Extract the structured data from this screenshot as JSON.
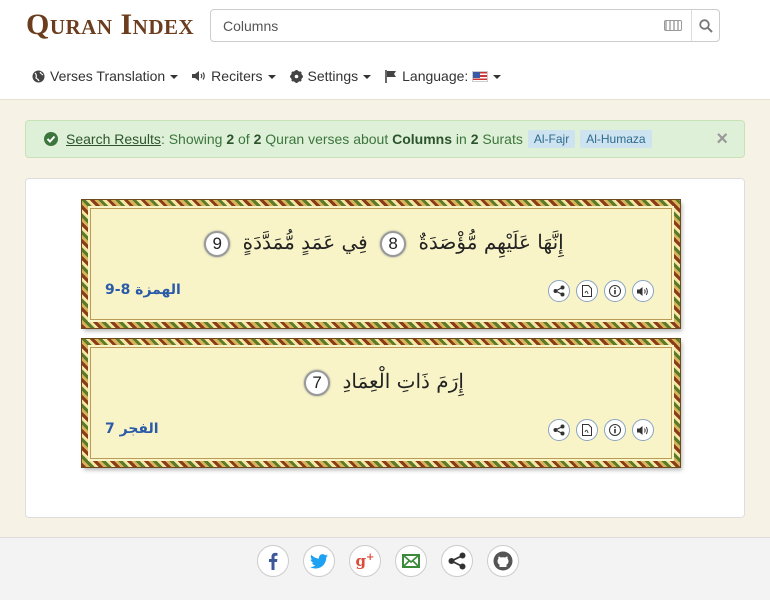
{
  "header": {
    "logo_text": "Quran Index",
    "search": {
      "value": "Columns",
      "placeholder": ""
    }
  },
  "nav": {
    "items": [
      {
        "label": "Verses Translation",
        "icon": "globe-icon"
      },
      {
        "label": "Reciters",
        "icon": "speaker-icon"
      },
      {
        "label": "Settings",
        "icon": "gear-icon"
      },
      {
        "label": "Language:",
        "icon": "flag-icon"
      }
    ]
  },
  "alert": {
    "link": "Search Results",
    "prefix": ": Showing ",
    "count_shown": "2",
    "of": " of ",
    "count_total": "2",
    "middle": " Quran verses about ",
    "query": "Columns",
    "in": " in ",
    "surat_count": "2",
    "suffix": " Surats",
    "tags": [
      "Al-Fajr",
      "Al-Humaza"
    ],
    "close": "×"
  },
  "verses": [
    {
      "text_a": "إِنَّهَا عَلَيْهِم مُّؤْصَدَةٌ",
      "num_a": "8",
      "text_b": "فِي عَمَدٍ مُّمَدَّدَةٍ",
      "num_b": "9",
      "ref": "الهمزة 8-9"
    },
    {
      "text_a": "إِرَمَ ذَاتِ الْعِمَادِ",
      "num_a": "7",
      "ref": "الفجر 7"
    }
  ],
  "colors": {
    "alert_bg": "#dff0d8",
    "verse_bg": "#f8f4c8",
    "ref_blue": "#2a5aa8",
    "logo_brown": "#6b3d1e"
  },
  "footer": {
    "social": [
      "facebook-icon",
      "twitter-icon",
      "google-plus-icon",
      "email-icon",
      "share-icon",
      "github-icon"
    ]
  }
}
